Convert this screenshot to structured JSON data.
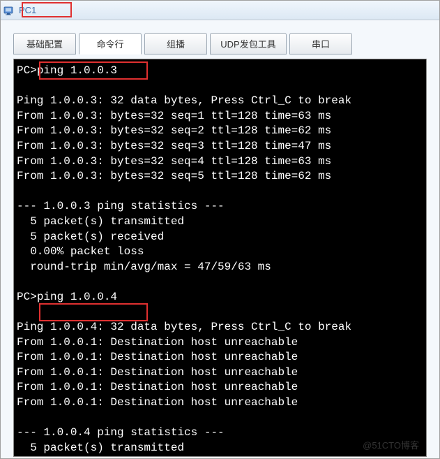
{
  "window": {
    "title": "PC1"
  },
  "tabs": [
    {
      "label": "基础配置"
    },
    {
      "label": "命令行"
    },
    {
      "label": "组播"
    },
    {
      "label": "UDP发包工具"
    },
    {
      "label": "串口"
    }
  ],
  "activeTab": 1,
  "terminal": {
    "prompt1": "PC>",
    "command1": "ping 1.0.0.3",
    "block1": [
      "",
      "Ping 1.0.0.3: 32 data bytes, Press Ctrl_C to break",
      "From 1.0.0.3: bytes=32 seq=1 ttl=128 time=63 ms",
      "From 1.0.0.3: bytes=32 seq=2 ttl=128 time=62 ms",
      "From 1.0.0.3: bytes=32 seq=3 ttl=128 time=47 ms",
      "From 1.0.0.3: bytes=32 seq=4 ttl=128 time=63 ms",
      "From 1.0.0.3: bytes=32 seq=5 ttl=128 time=62 ms",
      "",
      "--- 1.0.0.3 ping statistics ---",
      "  5 packet(s) transmitted",
      "  5 packet(s) received",
      "  0.00% packet loss",
      "  round-trip min/avg/max = 47/59/63 ms",
      ""
    ],
    "prompt2": "PC>",
    "command2": "ping 1.0.0.4",
    "block2": [
      "",
      "Ping 1.0.0.4: 32 data bytes, Press Ctrl_C to break",
      "From 1.0.0.1: Destination host unreachable",
      "From 1.0.0.1: Destination host unreachable",
      "From 1.0.0.1: Destination host unreachable",
      "From 1.0.0.1: Destination host unreachable",
      "From 1.0.0.1: Destination host unreachable",
      "",
      "--- 1.0.0.4 ping statistics ---",
      "  5 packet(s) transmitted"
    ]
  },
  "watermark": "@51CTO博客"
}
